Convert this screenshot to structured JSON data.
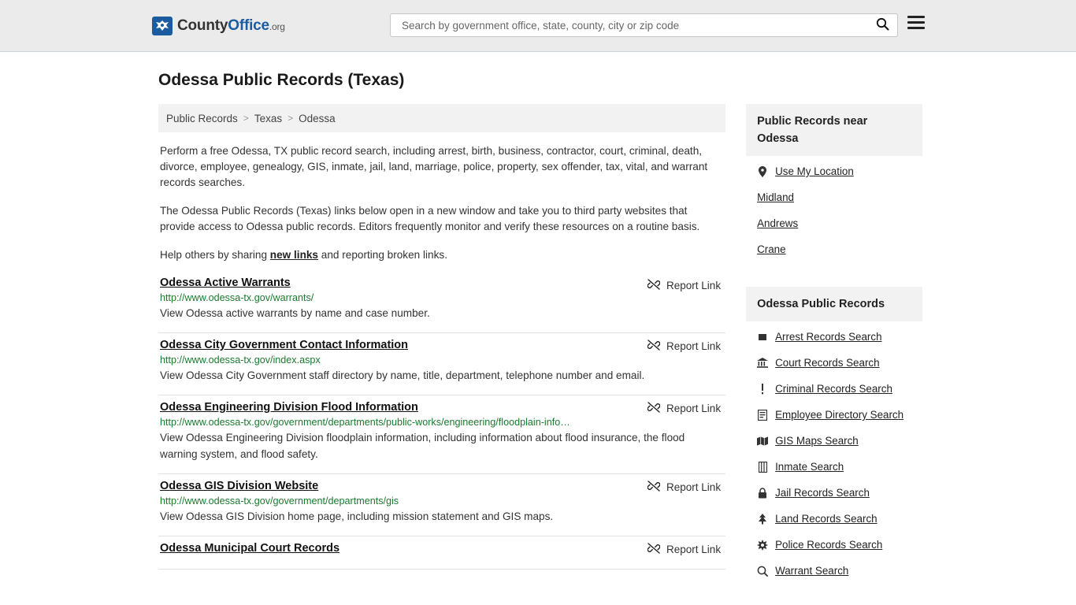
{
  "header": {
    "logo_text_county": "County",
    "logo_text_office": "Office",
    "logo_text_dotorg": ".org",
    "logo_icon": "eagle-icon",
    "search_placeholder": "Search by government office, state, county, city or zip code",
    "search_value": "",
    "search_icon": "search-icon",
    "menu_icon": "hamburger-menu-icon"
  },
  "page": {
    "title": "Odessa Public Records (Texas)"
  },
  "breadcrumb": {
    "items": [
      {
        "label": "Public Records"
      },
      {
        "label": "Texas"
      },
      {
        "label": "Odessa"
      }
    ],
    "separator": ">"
  },
  "intro": {
    "paragraph1": "Perform a free Odessa, TX public record search, including arrest, birth, business, contractor, court, criminal, death, divorce, employee, genealogy, GIS, inmate, jail, land, marriage, police, property, sex offender, tax, vital, and warrant records searches.",
    "paragraph2": "The Odessa Public Records (Texas) links below open in a new window and take you to third party websites that provide access to Odessa public records. Editors frequently monitor and verify these resources on a routine basis.",
    "paragraph3_before": "Help others by sharing ",
    "paragraph3_link": "new links",
    "paragraph3_after": " and reporting broken links."
  },
  "results": {
    "report_label": "Report Link",
    "report_icon": "broken-link-icon",
    "items": [
      {
        "title": "Odessa Active Warrants",
        "url": "http://www.odessa-tx.gov/warrants/",
        "description": "View Odessa active warrants by name and case number."
      },
      {
        "title": "Odessa City Government Contact Information",
        "url": "http://www.odessa-tx.gov/index.aspx",
        "description": "View Odessa City Government staff directory by name, title, department, telephone number and email."
      },
      {
        "title": "Odessa Engineering Division Flood Information",
        "url": "http://www.odessa-tx.gov/government/departments/public-works/engineering/floodplain-info…",
        "description": "View Odessa Engineering Division floodplain information, including information about flood insurance, the flood warning system, and flood safety."
      },
      {
        "title": "Odessa GIS Division Website",
        "url": "http://www.odessa-tx.gov/government/departments/gis",
        "description": "View Odessa GIS Division home page, including mission statement and GIS maps."
      },
      {
        "title": "Odessa Municipal Court Records",
        "url": "",
        "description": ""
      }
    ]
  },
  "sidebar": {
    "near_box": {
      "heading": "Public Records near Odessa",
      "items": [
        {
          "label": "Use My Location",
          "icon": "map-pin-icon"
        },
        {
          "label": "Midland",
          "icon": ""
        },
        {
          "label": "Andrews",
          "icon": ""
        },
        {
          "label": "Crane",
          "icon": ""
        }
      ]
    },
    "records_box": {
      "heading": "Odessa Public Records",
      "items": [
        {
          "label": "Arrest Records Search",
          "icon": "handcuffs-icon"
        },
        {
          "label": "Court Records Search",
          "icon": "courthouse-icon"
        },
        {
          "label": "Criminal Records Search",
          "icon": "exclamation-icon"
        },
        {
          "label": "Employee Directory Search",
          "icon": "id-card-icon"
        },
        {
          "label": "GIS Maps Search",
          "icon": "map-icon"
        },
        {
          "label": "Inmate Search",
          "icon": "jail-door-icon"
        },
        {
          "label": "Jail Records Search",
          "icon": "lock-icon"
        },
        {
          "label": "Land Records Search",
          "icon": "tree-icon"
        },
        {
          "label": "Police Records Search",
          "icon": "badge-star-icon"
        },
        {
          "label": "Warrant Search",
          "icon": "magnifier-icon"
        }
      ]
    }
  },
  "colors": {
    "header_bg": "#ebebeb",
    "link_green": "#1a7a2e",
    "brand_blue": "#1b5ba0",
    "panel_grey": "#f2f2f2"
  }
}
